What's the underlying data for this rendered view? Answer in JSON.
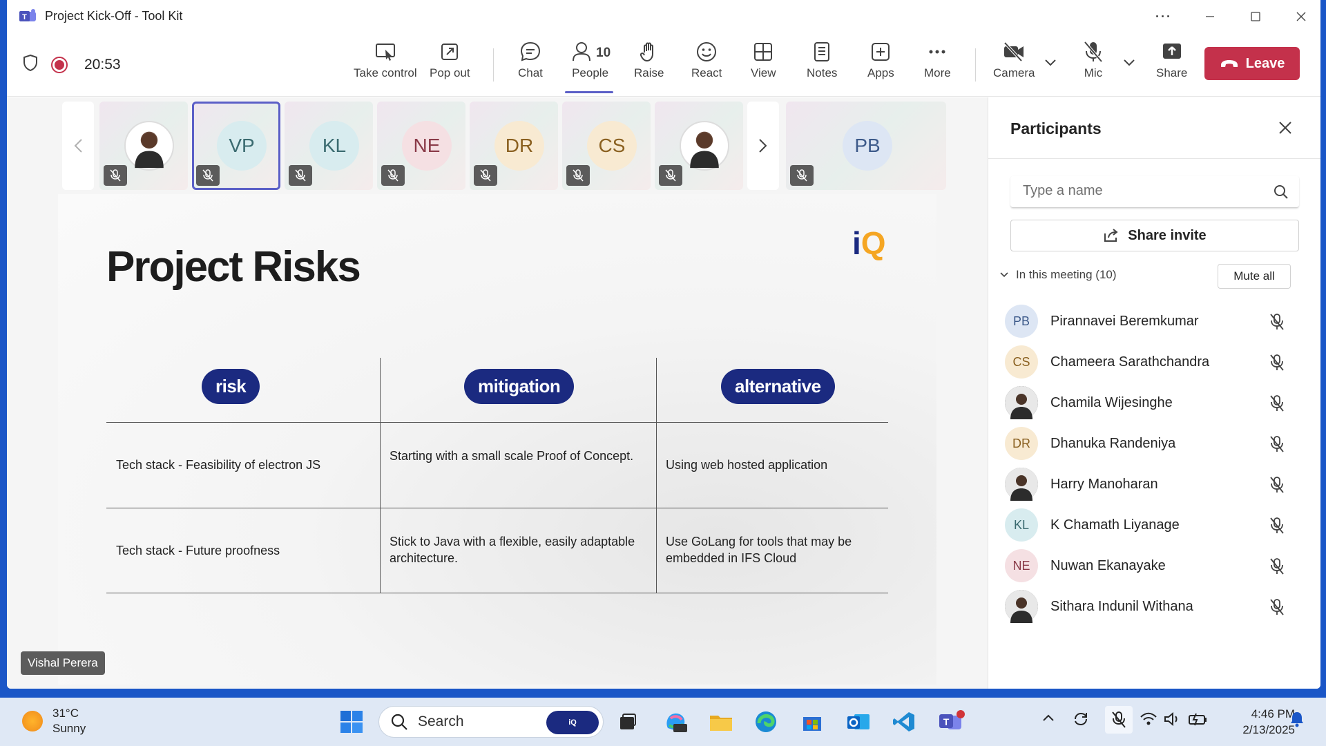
{
  "window": {
    "title": "Project Kick-Off - Tool Kit",
    "more_label": "···"
  },
  "toolbar": {
    "timer": "20:53",
    "take_control": "Take control",
    "pop_out": "Pop out",
    "chat": "Chat",
    "people": "People",
    "people_count": "10",
    "raise": "Raise",
    "react": "React",
    "view": "View",
    "notes": "Notes",
    "apps": "Apps",
    "more": "More",
    "camera": "Camera",
    "mic": "Mic",
    "share": "Share",
    "leave": "Leave"
  },
  "strip": {
    "tiles": [
      {
        "initials": "",
        "photo": true
      },
      {
        "initials": "VP",
        "color": "#d8ecef",
        "text": "#3b6b70",
        "selected": true
      },
      {
        "initials": "KL",
        "color": "#d8ecef",
        "text": "#3b6b70"
      },
      {
        "initials": "NE",
        "color": "#f5e0e3",
        "text": "#8a3a48"
      },
      {
        "initials": "DR",
        "color": "#f8ead2",
        "text": "#8a6020"
      },
      {
        "initials": "CS",
        "color": "#f8ead2",
        "text": "#8a6020"
      },
      {
        "initials": "",
        "photo": true
      }
    ],
    "pinned": {
      "initials": "PB",
      "color": "#dde6f4",
      "text": "#3d5a8a"
    }
  },
  "slide": {
    "title": "Project Risks",
    "logo": "iQ",
    "headers": [
      "risk",
      "mitigation",
      "alternative"
    ],
    "rows": [
      [
        "Tech stack - Feasibility of electron JS",
        "Starting with a small scale Proof of Concept.",
        "Using web hosted application"
      ],
      [
        "Tech stack - Future proofness",
        "Stick to Java with a flexible, easily adaptable architecture.",
        "Use GoLang for tools that may be embedded in IFS Cloud"
      ]
    ]
  },
  "presenter_name": "Vishal Perera",
  "participants": {
    "title": "Participants",
    "search_placeholder": "Type a name",
    "share_invite": "Share invite",
    "in_meeting": "In this meeting (10)",
    "mute_all": "Mute all",
    "list": [
      {
        "initials": "PB",
        "name": "Pirannavei Beremkumar",
        "bg": "#dde6f4",
        "fg": "#3d5a8a"
      },
      {
        "initials": "CS",
        "name": "Chameera Sarathchandra",
        "bg": "#f8ead2",
        "fg": "#8a6020"
      },
      {
        "initials": "",
        "name": "Chamila Wijesinghe",
        "bg": "#333",
        "fg": "#fff"
      },
      {
        "initials": "DR",
        "name": "Dhanuka Randeniya",
        "bg": "#f8ead2",
        "fg": "#8a6020"
      },
      {
        "initials": "",
        "name": "Harry Manoharan",
        "bg": "#777",
        "fg": "#fff"
      },
      {
        "initials": "KL",
        "name": "K Chamath Liyanage",
        "bg": "#d8ecef",
        "fg": "#3b6b70"
      },
      {
        "initials": "NE",
        "name": "Nuwan Ekanayake",
        "bg": "#f5e0e3",
        "fg": "#8a3a48"
      },
      {
        "initials": "",
        "name": "Sithara Indunil Withana",
        "bg": "#555",
        "fg": "#fff"
      }
    ]
  },
  "taskbar": {
    "temperature": "31°C",
    "condition": "Sunny",
    "search_label": "Search",
    "search_badge": "iQ",
    "time": "4:46 PM",
    "date": "2/13/2025"
  }
}
